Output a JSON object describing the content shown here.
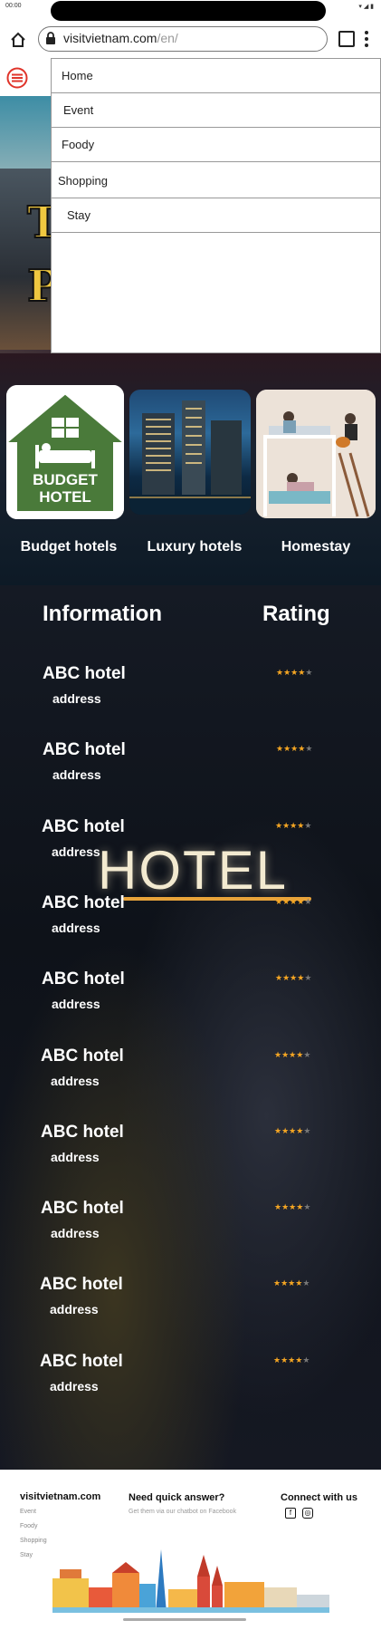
{
  "status": {
    "time": "00:00",
    "icons": "▾ ◢ ▮"
  },
  "browser": {
    "url_host": "visitvietnam.com",
    "url_path": "/en/"
  },
  "menu": {
    "items": [
      {
        "label": "Home"
      },
      {
        "label": "Event"
      },
      {
        "label": "Foody"
      },
      {
        "label": "Shopping"
      },
      {
        "label": "Stay"
      }
    ]
  },
  "hero": {
    "letter1": "T",
    "letter2": "P"
  },
  "categories": [
    {
      "label": "Budget hotels",
      "badge_line1": "BUDGET",
      "badge_line2": "HOTEL"
    },
    {
      "label": "Luxury hotels"
    },
    {
      "label": "Homestay"
    }
  ],
  "list": {
    "header_info": "Information",
    "header_rating": "Rating",
    "sign_text": "HOTEL",
    "hotels": [
      {
        "name": "ABC hotel",
        "address": "address",
        "rating": 4
      },
      {
        "name": "ABC hotel",
        "address": "address",
        "rating": 4
      },
      {
        "name": "ABC hotel",
        "address": "address",
        "rating": 4
      },
      {
        "name": "ABC hotel",
        "address": "address",
        "rating": 4
      },
      {
        "name": "ABC hotel",
        "address": "address",
        "rating": 4
      },
      {
        "name": "ABC hotel",
        "address": "address",
        "rating": 4
      },
      {
        "name": "ABC hotel",
        "address": "address",
        "rating": 4
      },
      {
        "name": "ABC hotel",
        "address": "address",
        "rating": 4
      },
      {
        "name": "ABC hotel",
        "address": "address",
        "rating": 4
      },
      {
        "name": "ABC hotel",
        "address": "address",
        "rating": 4
      }
    ]
  },
  "footer": {
    "site": "visitvietnam.com",
    "links": [
      "Event",
      "Foody",
      "Shopping",
      "Stay"
    ],
    "quick_title": "Need quick answer?",
    "quick_sub": "Get them via our chatbot on Facebook",
    "connect_title": "Connect with us",
    "social": [
      {
        "icon": "facebook-icon",
        "glyph": "f"
      },
      {
        "icon": "instagram-icon",
        "glyph": "◎"
      }
    ]
  },
  "colors": {
    "star_on": "#f5a623",
    "star_off": "#777777",
    "menu_accent": "#e0342a"
  }
}
